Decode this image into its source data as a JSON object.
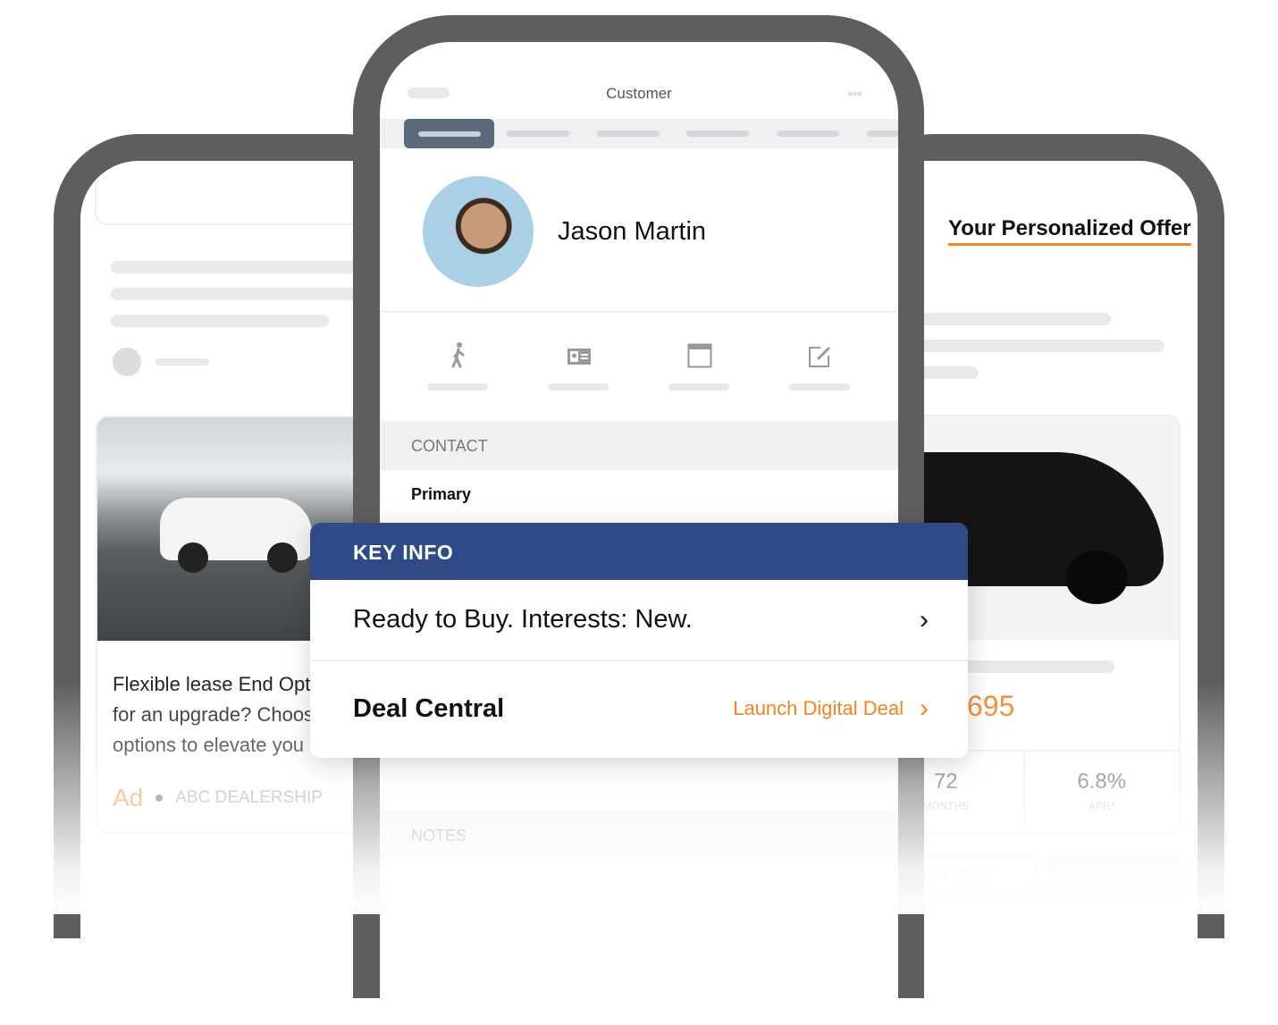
{
  "colors": {
    "bezel": "#5e5e5e",
    "accent": "#f5821f",
    "key_info_header": "#2f4a87",
    "skeleton": "#e8e9eb"
  },
  "left_phone": {
    "ad_text_lines": [
      "Flexible lease End Opt",
      "for an upgrade? Choos",
      "options to elevate you"
    ],
    "ad_label": "Ad",
    "dealer": "ABC DEALERSHIP"
  },
  "center_phone": {
    "title": "Customer",
    "menu_icon": "more-dots-icon",
    "customer_name": "Jason Martin",
    "actions": [
      {
        "icon": "walking-person-icon"
      },
      {
        "icon": "id-card-icon"
      },
      {
        "icon": "browser-window-icon"
      },
      {
        "icon": "edit-icon"
      }
    ],
    "contact_section": "CONTACT",
    "primary_label": "Primary",
    "notes_section": "NOTES"
  },
  "key_info": {
    "header": "KEY INFO",
    "summary": "Ready to Buy. Interests: New.",
    "deal_title": "Deal Central",
    "deal_link": "Launch Digital Deal"
  },
  "right_phone": {
    "title": "Your Personalized Offer",
    "price": "695",
    "term_value": "72",
    "term_label": "MONTHS",
    "apr_value": "6.8%",
    "apr_label": "APR*",
    "payment_button": "PAYMENT",
    "contact_button": "CONTACT US"
  }
}
